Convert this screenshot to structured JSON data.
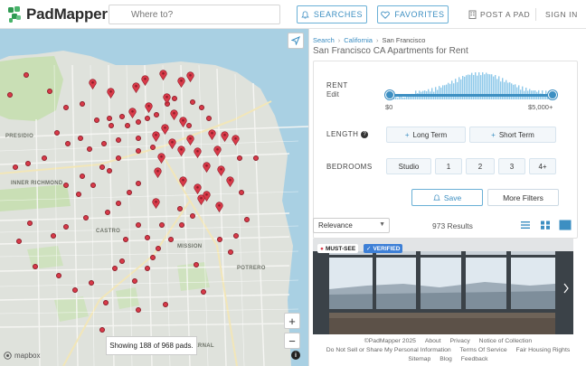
{
  "header": {
    "logo_text": "PadMapper",
    "search_placeholder": "Where to?",
    "searches_label": "SEARCHES",
    "favorites_label": "FAVORITES",
    "post_label": "POST A PAD",
    "signin_label": "SIGN IN"
  },
  "map": {
    "labels": {
      "presidio": "PRESIDIO",
      "inner_richmond": "INNER RICHMOND",
      "castro": "CASTRO",
      "bernal": "BERNAL",
      "mission": "MISSION",
      "potrero": "POTRERO"
    },
    "showing_text": "Showing 188 of 968 pads.",
    "zoom_in": "+",
    "zoom_out": "−",
    "attribution": "mapbox",
    "info": "i"
  },
  "panel": {
    "breadcrumbs": [
      "Search",
      "California",
      "San Francisco"
    ],
    "breadcrumb_sep": "›",
    "page_title": "San Francisco CA Apartments for Rent",
    "rent": {
      "label": "RENT",
      "edit": "Edit",
      "min_label": "$0",
      "max_label": "$5,000+",
      "selected_min_fraction": 0.0,
      "selected_max_fraction": 1.0
    },
    "length": {
      "label": "LENGTH",
      "options": [
        "Long Term",
        "Short Term"
      ]
    },
    "bedrooms": {
      "label": "BEDROOMS",
      "options": [
        "Studio",
        "1",
        "2",
        "3",
        "4+"
      ]
    },
    "save_label": "Save",
    "more_filters_label": "More Filters",
    "sort": {
      "selected": "Relevance"
    },
    "results_text": "973 Results",
    "listing": {
      "badge_must_see": "MUST-SEE",
      "badge_verified": "VERIFIED"
    },
    "footer": {
      "row1": [
        "©PadMapper 2025",
        "About",
        "Privacy",
        "Notice of Collection"
      ],
      "row2": [
        "Do Not Sell or Share My Personal Information",
        "Terms Of Service",
        "Fair Housing Rights"
      ],
      "row3": [
        "Sitemap",
        "Blog",
        "Feedback"
      ]
    }
  },
  "colors": {
    "accent": "#3d8fc2",
    "pin": "#d93a49",
    "histogram": "#8ec9ea",
    "must_see": "#d93a49",
    "verified": "#3d7fd6"
  }
}
